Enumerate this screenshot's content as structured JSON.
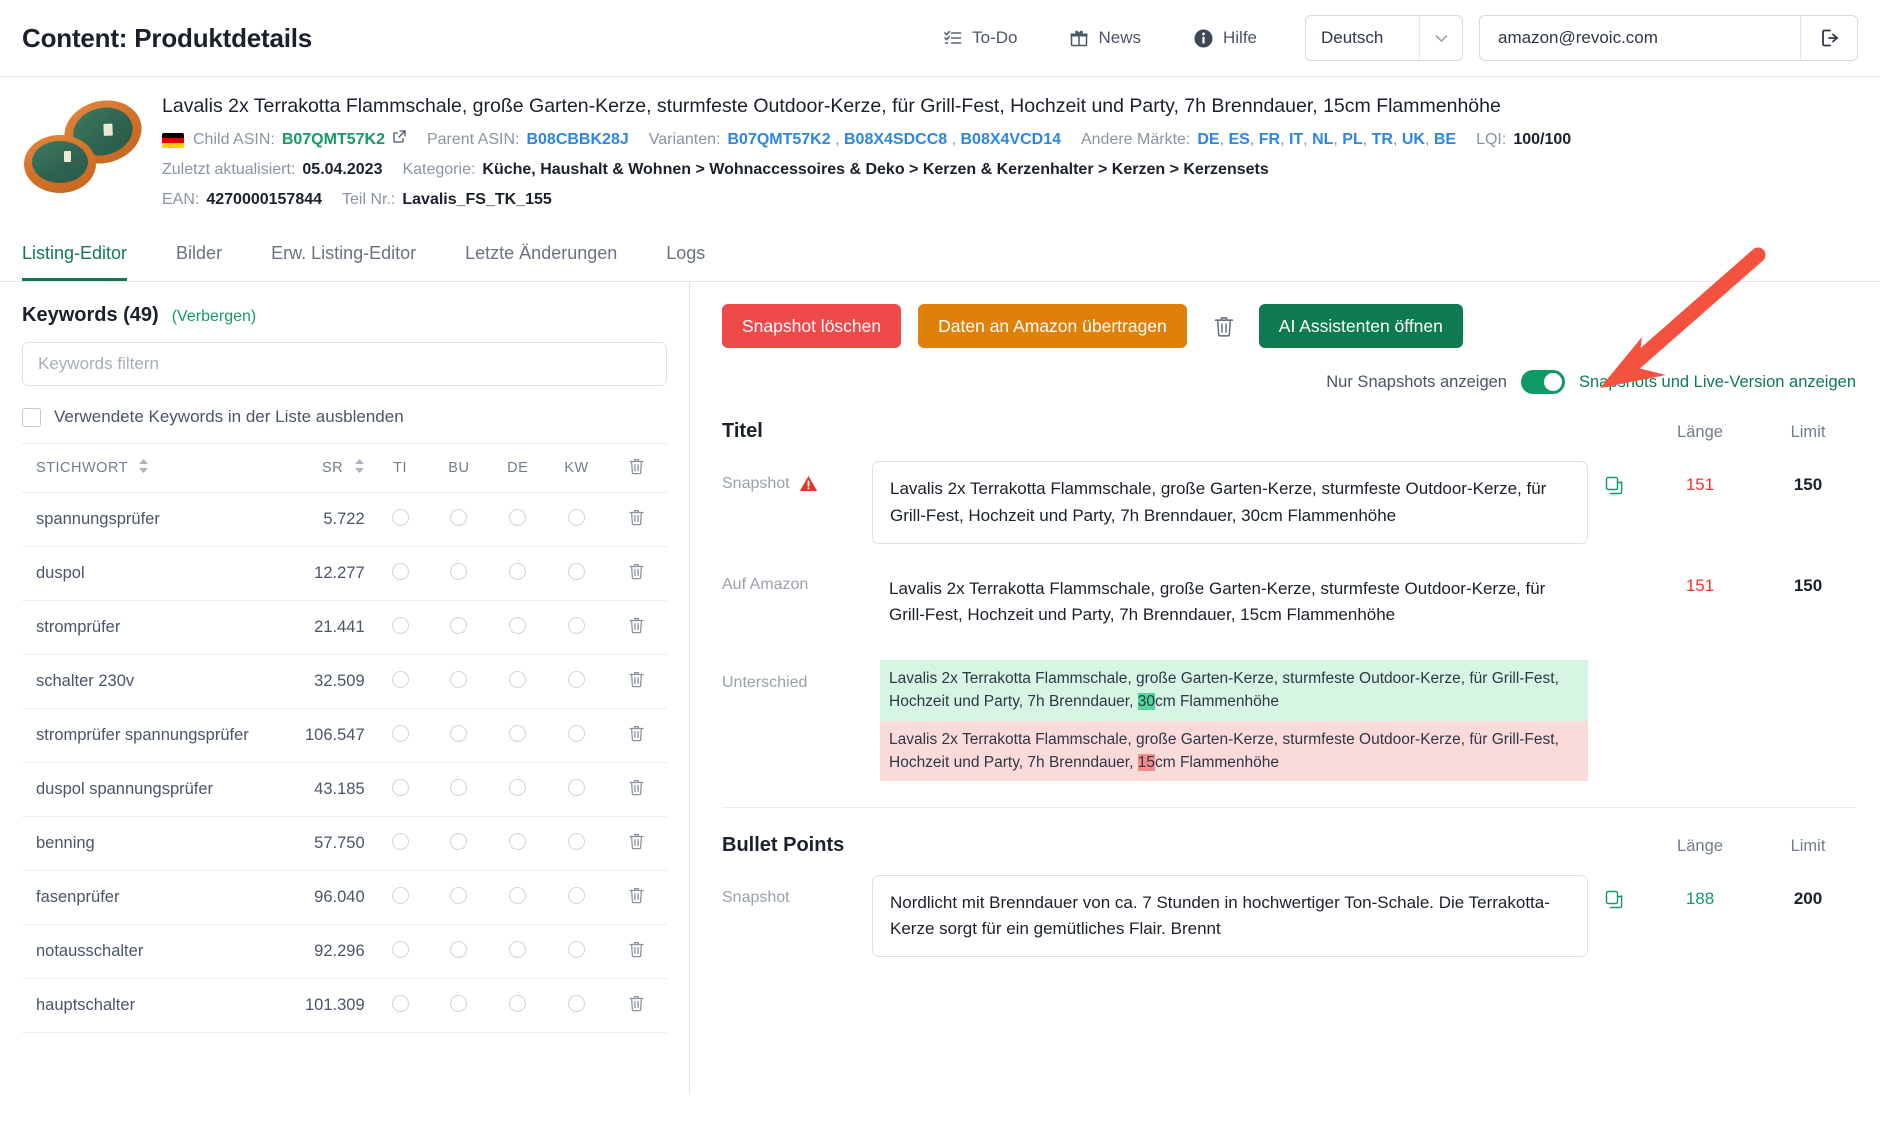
{
  "header": {
    "app_title": "Content: Produktdetails",
    "nav": [
      {
        "label": "To-Do",
        "icon": "todo-list-icon"
      },
      {
        "label": "News",
        "icon": "gift-icon"
      },
      {
        "label": "Hilfe",
        "icon": "info-icon"
      }
    ],
    "language": "Deutsch",
    "user_email": "amazon@revoic.com",
    "logout_icon": "logout-icon"
  },
  "product": {
    "title": "Lavalis 2x Terrakotta Flammschale, große Garten-Kerze, sturmfeste Outdoor-Kerze, für Grill-Fest, Hochzeit und Party, 7h Brenndauer, 15cm Flammenhöhe",
    "flag": "de-flag-icon",
    "child_asin_label": "Child ASIN:",
    "child_asin": "B07QMT57K2",
    "parent_asin_label": "Parent ASIN:",
    "parent_asin": "B08CBBK28J",
    "varianten_label": "Varianten:",
    "varianten": [
      "B07QMT57K2",
      "B08X4SDCC8",
      "B08X4VCD14"
    ],
    "andere_maerkte_label": "Andere Märkte:",
    "andere_maerkte": [
      "DE",
      "ES",
      "FR",
      "IT",
      "NL",
      "PL",
      "TR",
      "UK",
      "BE"
    ],
    "lqi_label": "LQI:",
    "lqi_value": "100/100",
    "updated_label": "Zuletzt aktualisiert:",
    "updated_value": "05.04.2023",
    "kategorie_label": "Kategorie:",
    "kategorie_value": "Küche, Haushalt & Wohnen > Wohnaccessoires & Deko > Kerzen & Kerzenhalter > Kerzen > Kerzensets",
    "ean_label": "EAN:",
    "ean_value": "4270000157844",
    "teilnr_label": "Teil Nr.:",
    "teilnr_value": "Lavalis_FS_TK_155"
  },
  "tabs": [
    {
      "label": "Listing-Editor",
      "active": true
    },
    {
      "label": "Bilder",
      "active": false
    },
    {
      "label": "Erw. Listing-Editor",
      "active": false
    },
    {
      "label": "Letzte Änderungen",
      "active": false
    },
    {
      "label": "Logs",
      "active": false
    }
  ],
  "keywords_panel": {
    "title": "Keywords (49)",
    "toggle_label": "(Verbergen)",
    "filter_placeholder": "Keywords filtern",
    "filter_value": "",
    "hide_used_label": "Verwendete Keywords in der Liste ausblenden",
    "hide_used_checked": false,
    "columns": [
      "STICHWORT",
      "SR",
      "TI",
      "BU",
      "DE",
      "KW",
      "delete-icon"
    ],
    "rows": [
      {
        "keyword": "spannungsprüfer",
        "sr": "5.722"
      },
      {
        "keyword": "duspol",
        "sr": "12.277"
      },
      {
        "keyword": "stromprüfer",
        "sr": "21.441"
      },
      {
        "keyword": "schalter 230v",
        "sr": "32.509"
      },
      {
        "keyword": "stromprüfer spannungsprüfer",
        "sr": "106.547"
      },
      {
        "keyword": "duspol spannungsprüfer",
        "sr": "43.185"
      },
      {
        "keyword": "benning",
        "sr": "57.750"
      },
      {
        "keyword": "fasenprüfer",
        "sr": "96.040"
      },
      {
        "keyword": "notausschalter",
        "sr": "92.296"
      },
      {
        "keyword": "hauptschalter",
        "sr": "101.309"
      }
    ]
  },
  "toolbar": {
    "delete_snapshot_label": "Snapshot löschen",
    "transfer_label": "Daten an Amazon übertragen",
    "trash_icon": "trash-icon",
    "ai_assistant_label": "AI Assistenten öffnen"
  },
  "view_toggle": {
    "off_label": "Nur Snapshots anzeigen",
    "on_label": "Snapshots und Live-Version anzeigen",
    "checked": true
  },
  "titel_section": {
    "title": "Titel",
    "col_laenge": "Länge",
    "col_limit": "Limit",
    "snapshot": {
      "label": "Snapshot",
      "warning_icon": "warning-triangle-icon",
      "copy_icon": "copy-icon",
      "text": "Lavalis 2x Terrakotta Flammschale, große Garten-Kerze, sturmfeste Outdoor-Kerze, für Grill-Fest, Hochzeit und Party, 7h Brenndauer, 30cm Flammenhöhe",
      "laenge": "151",
      "limit": "150"
    },
    "amazon": {
      "label": "Auf Amazon",
      "text": "Lavalis 2x Terrakotta Flammschale, große Garten-Kerze, sturmfeste Outdoor-Kerze, für Grill-Fest, Hochzeit und Party, 7h Brenndauer, 15cm Flammenhöhe",
      "laenge": "151",
      "limit": "150"
    },
    "diff": {
      "label": "Unterschied",
      "added_prefix": "Lavalis 2x Terrakotta Flammschale, große Garten-Kerze, sturmfeste Outdoor-Kerze, für Grill-Fest, Hochzeit und Party, 7h Brenndauer, ",
      "added_highlight": "30",
      "added_suffix": "cm Flammenhöhe",
      "removed_prefix": "Lavalis 2x Terrakotta Flammschale, große Garten-Kerze, sturmfeste Outdoor-Kerze, für Grill-Fest, Hochzeit und Party, 7h Brenndauer, ",
      "removed_highlight": "15",
      "removed_suffix": "cm Flammenhöhe"
    }
  },
  "bullet_section": {
    "title": "Bullet Points",
    "col_laenge": "Länge",
    "col_limit": "Limit",
    "snapshot": {
      "label": "Snapshot",
      "copy_icon": "copy-icon",
      "text": "Nordlicht mit Brenndauer von ca. 7 Stunden in hochwertiger Ton-Schale. Die Terrakotta-Kerze sorgt für ein gemütliches Flair. Brennt",
      "laenge": "188",
      "limit": "200"
    }
  },
  "annotation": {
    "arrow_color": "#f4513f",
    "points_to": "AI Assistenten öffnen"
  },
  "colors": {
    "brand_green": "#107a52",
    "danger_red": "#ef4a4a",
    "warning_orange": "#df8109",
    "success_green": "#0d7a4f",
    "link_blue": "#2b87e3",
    "link_green": "#159a63"
  }
}
